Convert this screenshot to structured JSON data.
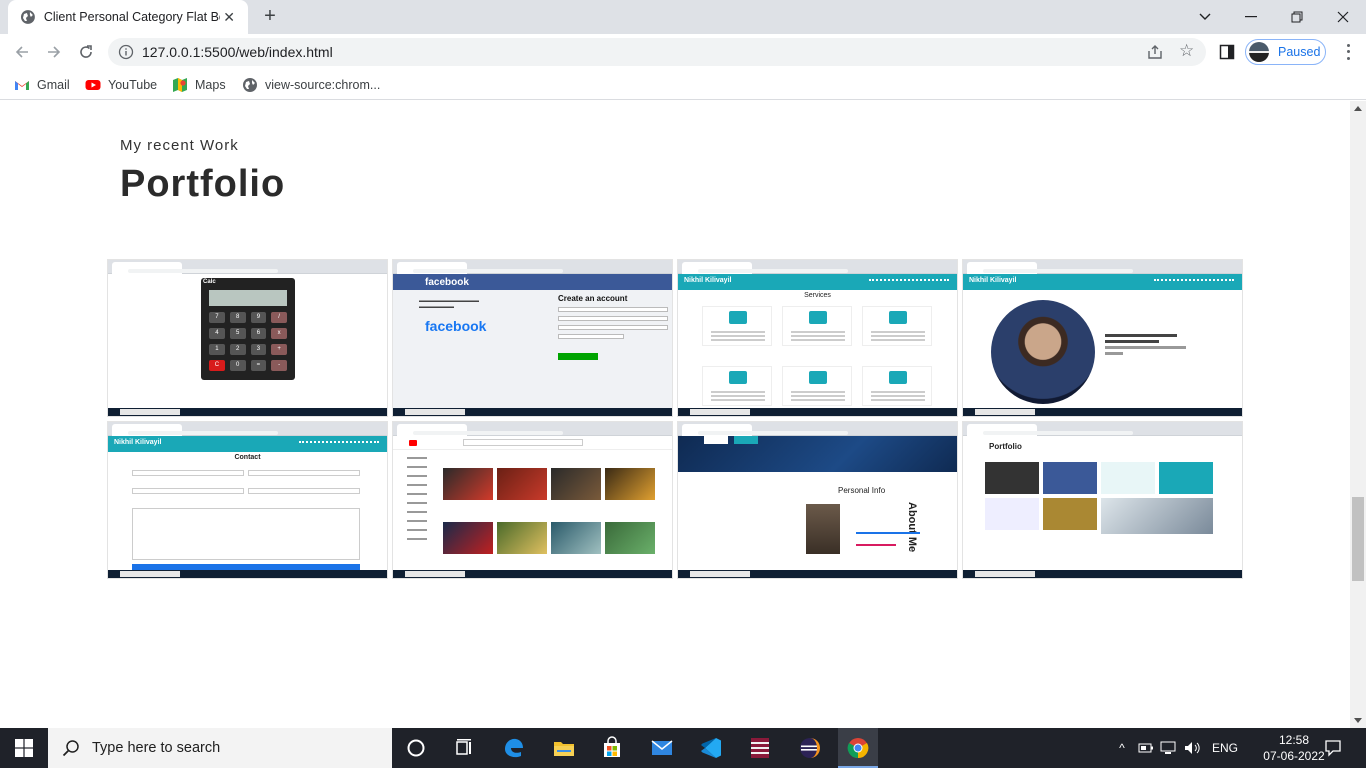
{
  "browser": {
    "tab_title": "Client Personal Category Flat Boo",
    "url": "127.0.0.1:5500/web/index.html",
    "profile_status": "Paused",
    "bookmarks": [
      {
        "label": "Gmail",
        "icon": "gmail-icon"
      },
      {
        "label": "YouTube",
        "icon": "youtube-icon"
      },
      {
        "label": "Maps",
        "icon": "maps-icon"
      },
      {
        "label": "view-source:chrom...",
        "icon": "globe-icon"
      }
    ]
  },
  "page": {
    "subtitle": "My recent Work",
    "title": "Portfolio",
    "thumbnails": [
      {
        "name": "calculator",
        "caption": "Calc"
      },
      {
        "name": "facebook-clone",
        "logo": "facebook",
        "big_logo": "facebook",
        "heading": "Create an account"
      },
      {
        "name": "services-page",
        "nav_name": "Nikhil Kilivayil",
        "section": "Services"
      },
      {
        "name": "profile-page",
        "nav_name": "Nikhil Kilivayil"
      },
      {
        "name": "contact-page",
        "nav_name": "Nikhil Kilivayil",
        "section": "Contact"
      },
      {
        "name": "youtube-clone"
      },
      {
        "name": "about-page",
        "section": "Personal Info",
        "vertical": "About Me"
      },
      {
        "name": "portfolio-page",
        "section": "Portfolio"
      }
    ]
  },
  "taskbar": {
    "search_placeholder": "Type here to search",
    "language": "ENG",
    "time": "12:58",
    "date": "07-06-2022"
  },
  "colors": {
    "teal": "#1aa8b7",
    "facebook_blue": "#3b5998",
    "chrome_accent": "#1a73e8"
  }
}
